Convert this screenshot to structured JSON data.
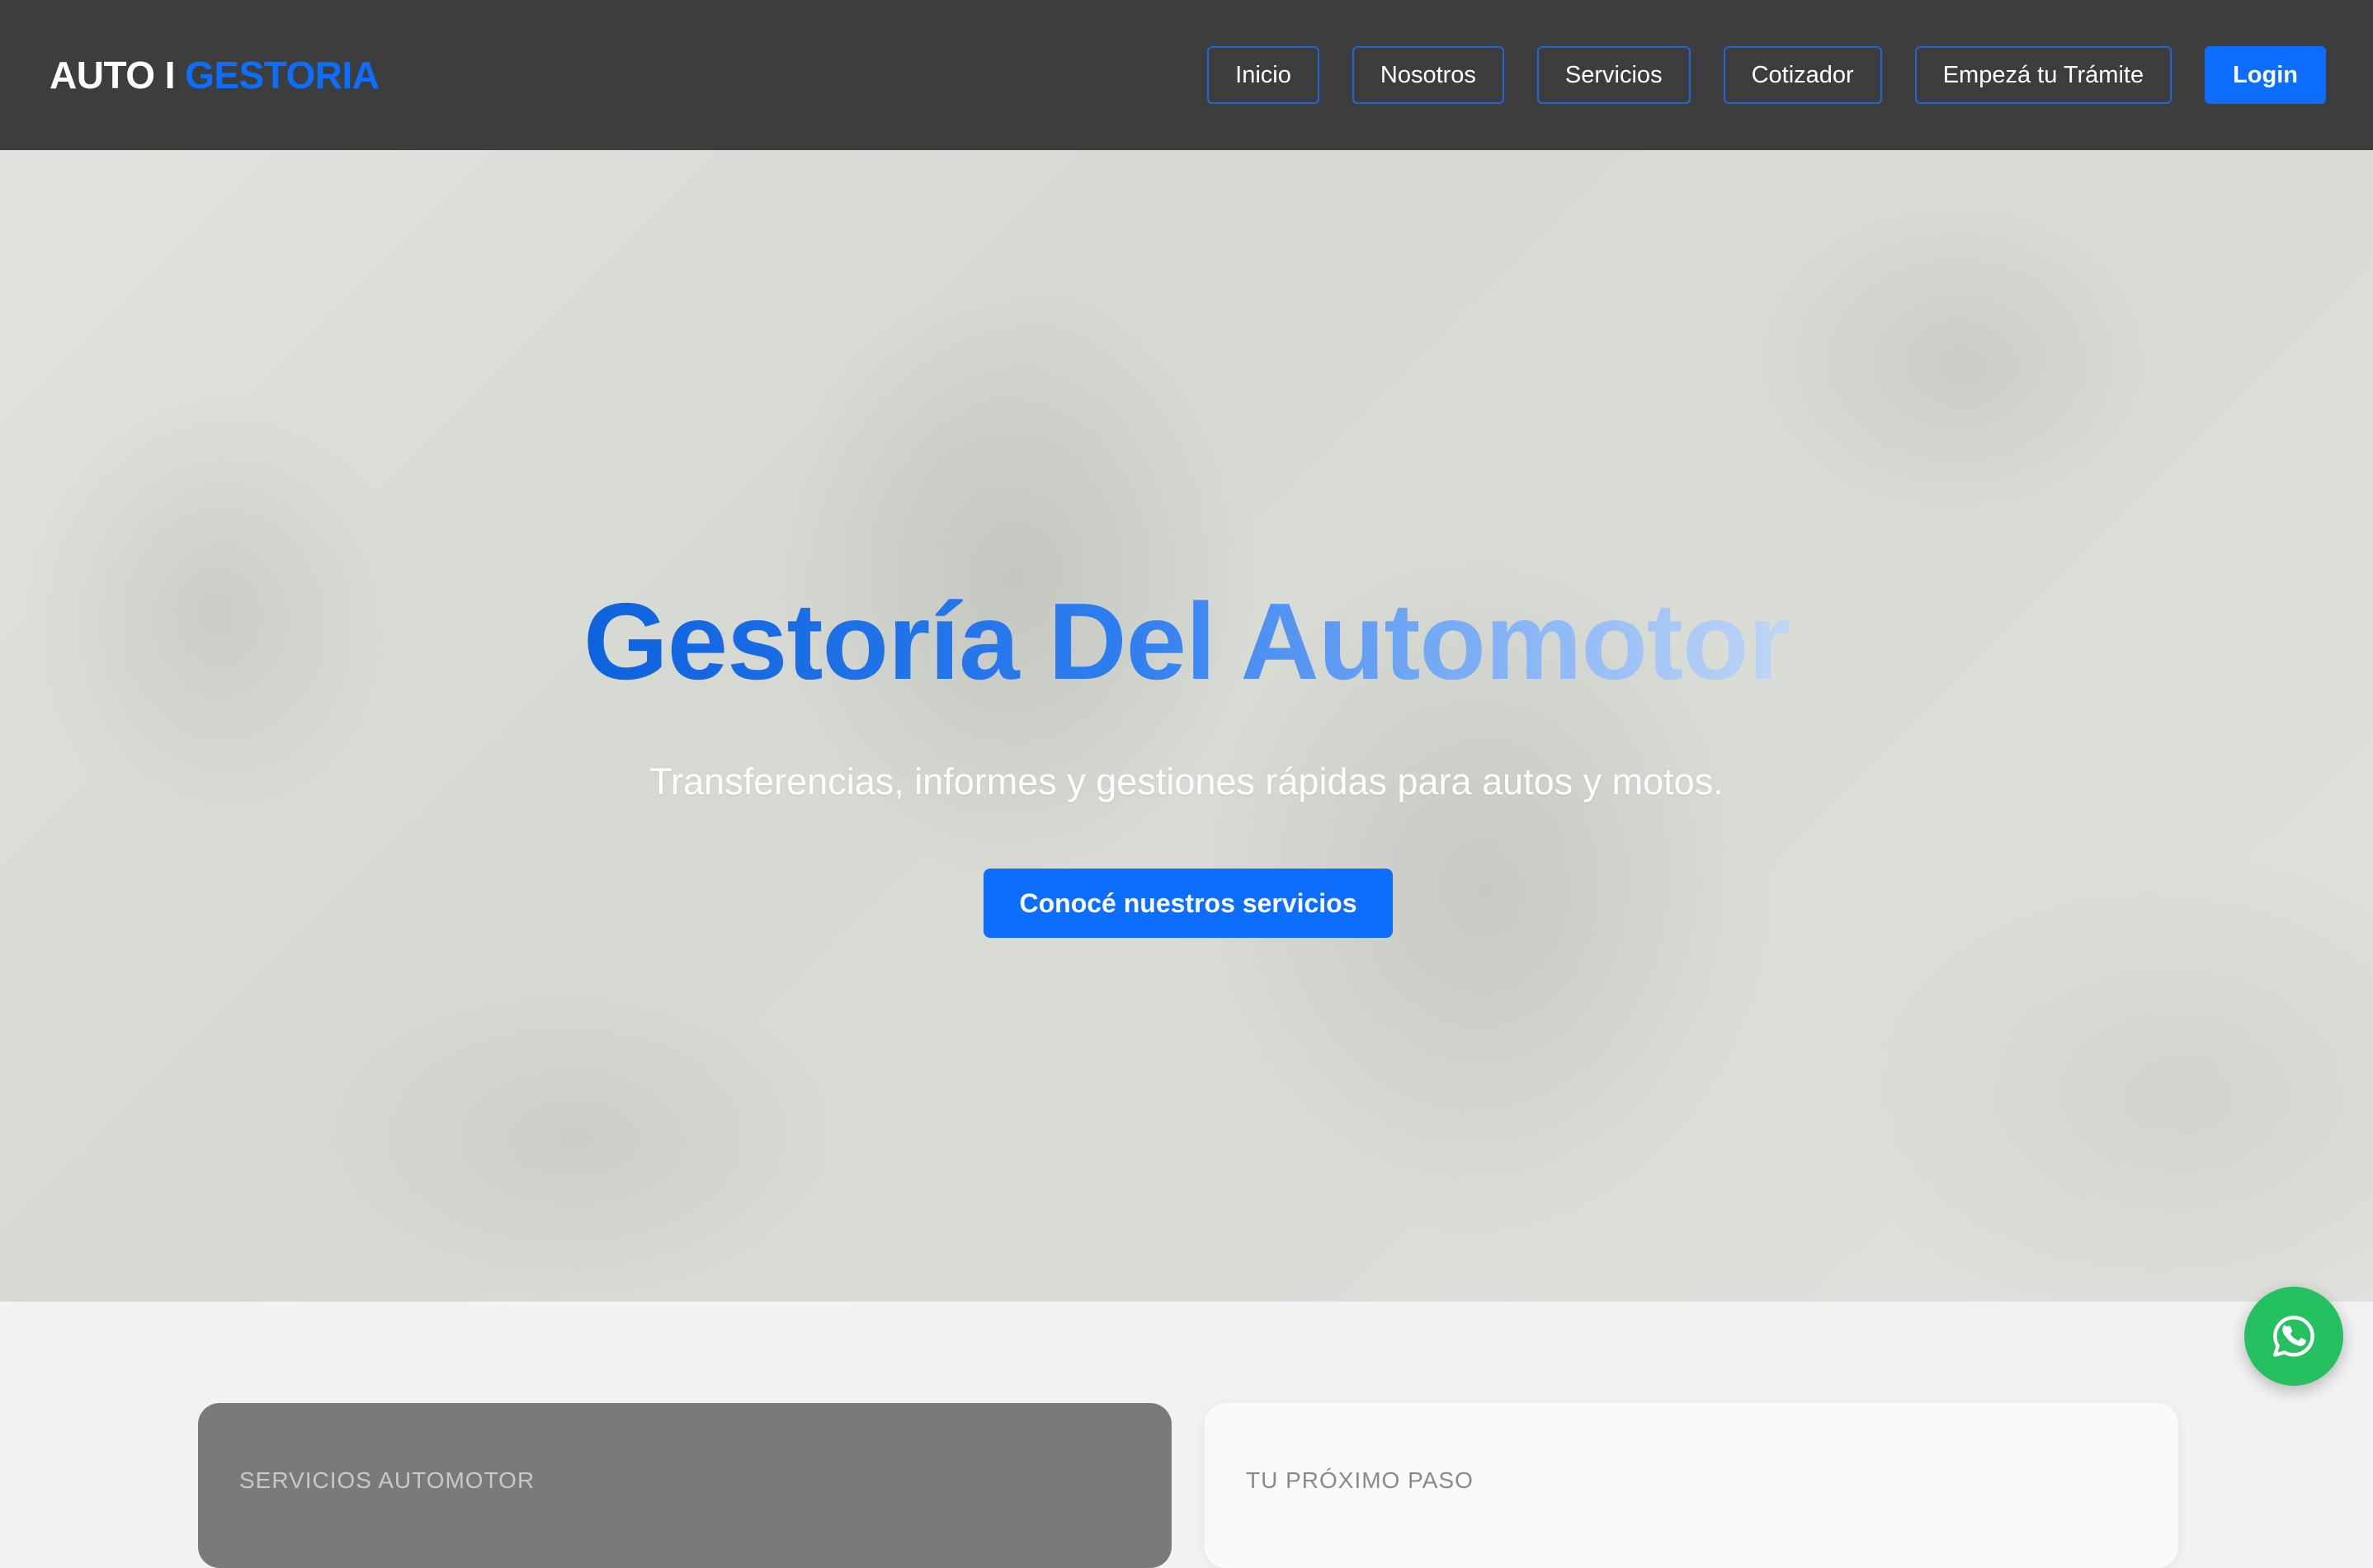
{
  "brand": {
    "part1": "AUTO I",
    "part2": "GESTORIA"
  },
  "nav": {
    "items": [
      {
        "label": "Inicio"
      },
      {
        "label": "Nosotros"
      },
      {
        "label": "Servicios"
      },
      {
        "label": "Cotizador"
      },
      {
        "label": "Empezá tu Trámite"
      }
    ],
    "login_label": "Login"
  },
  "hero": {
    "title": "Gestoría Del Automotor",
    "subtitle": "Transferencias, informes y gestiones rápidas para autos y motos.",
    "cta_label": "Conocé nuestros servicios"
  },
  "cards": [
    {
      "eyebrow": "SERVICIOS AUTOMOTOR"
    },
    {
      "eyebrow": "TU PRÓXIMO PASO"
    }
  ],
  "fab": {
    "icon": "whatsapp-icon"
  },
  "colors": {
    "accent": "#0d6efd",
    "navbar_bg": "#3d3d3d",
    "whatsapp": "#25c160"
  }
}
